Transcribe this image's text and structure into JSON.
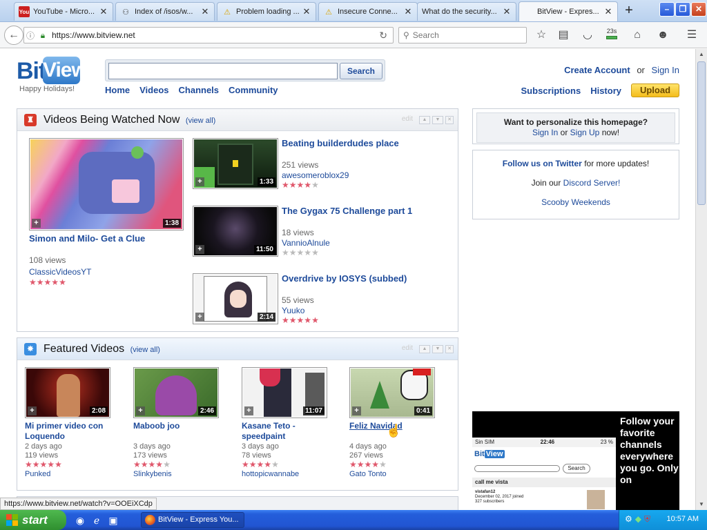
{
  "browser": {
    "tabs": [
      {
        "label": "YouTube - Micro...",
        "icon": "youtube-icon",
        "color": "#cc2020"
      },
      {
        "label": "Index of /isos/w...",
        "icon": "folder-icon",
        "color": "#555555"
      },
      {
        "label": "Problem loading ...",
        "icon": "warning-icon",
        "color": "#e8b400"
      },
      {
        "label": "Insecure Conne...",
        "icon": "warning-icon",
        "color": "#e8b400"
      },
      {
        "label": "What do the security...",
        "icon": "",
        "color": ""
      },
      {
        "label": "BitView - Expres...",
        "icon": "",
        "color": ""
      }
    ],
    "url": "https://www.bitview.net",
    "search_placeholder": "Search",
    "timer_label": "23s"
  },
  "site": {
    "logo_bit": "Bit",
    "logo_view": "View",
    "tagline": "Happy Holidays!",
    "search_button": "Search",
    "nav": [
      "Home",
      "Videos",
      "Channels",
      "Community"
    ],
    "create_account": "Create Account",
    "or": "or",
    "sign_in": "Sign In",
    "subscriptions": "Subscriptions",
    "history": "History",
    "upload": "Upload"
  },
  "watched": {
    "title": "Videos Being Watched Now",
    "view_all": "(view all)",
    "edit": "edit",
    "main": {
      "title": "Simon and Milo- Get a Clue",
      "views": "108 views",
      "user": "ClassicVideosYT",
      "duration": "1:38",
      "rating": 5
    },
    "list": [
      {
        "title": "Beating builderdudes place",
        "views": "251 views",
        "user": "awesomeroblox29",
        "duration": "1:33",
        "rating": 4
      },
      {
        "title": "The Gygax 75 Challenge part 1",
        "views": "18 views",
        "user": "VannioAlnule",
        "duration": "11:50",
        "rating": 0
      },
      {
        "title": "Overdrive by IOSYS (subbed)",
        "views": "55 views",
        "user": "Yuuko",
        "duration": "2:14",
        "rating": 5
      }
    ]
  },
  "featured": {
    "title": "Featured Videos",
    "view_all": "(view all)",
    "edit": "edit",
    "items": [
      {
        "title": "Mi primer video con Loquendo",
        "age": "2 days ago",
        "views": "119 views",
        "user": "Punked",
        "duration": "2:08",
        "rating": 5
      },
      {
        "title": "Maboob joo",
        "age": "3 days ago",
        "views": "173 views",
        "user": "Slinkybenis",
        "duration": "2:46",
        "rating": 4
      },
      {
        "title": "Kasane Teto - speedpaint",
        "age": "3 days ago",
        "views": "78 views",
        "user": "hottopicwannabe",
        "duration": "11:07",
        "rating": 4
      },
      {
        "title": "Feliz Navidad",
        "age": "4 days ago",
        "views": "267 views",
        "user": "Gato Tonto",
        "duration": "0:41",
        "rating": 4
      }
    ]
  },
  "sidebar": {
    "personalize_title": "Want to personalize this homepage?",
    "personalize_sign_in": "Sign In",
    "personalize_or": "or",
    "personalize_sign_up": "Sign Up",
    "personalize_now": "now!",
    "twitter_link": "Follow us on Twitter",
    "twitter_rest": "for more updates!",
    "discord_pre": "Join our",
    "discord_link": "Discord Server!",
    "scooby": "Scooby Weekends"
  },
  "ad": {
    "text": "Follow your favorite channels everywhere you go. Only on",
    "status_left": "Sin SIM",
    "status_time": "22:46",
    "status_right": "23 %",
    "phone_search": "Search",
    "phone_user": "call me vista",
    "phone_name": "vistafan12",
    "phone_joined": "December 02, 2017 joined",
    "phone_subs": "327 subscribers"
  },
  "status_url": "https://www.bitview.net/watch?v=OOEiXCdp",
  "taskbar": {
    "start": "start",
    "item": "BitView - Express You...",
    "clock": "10:57 AM"
  }
}
